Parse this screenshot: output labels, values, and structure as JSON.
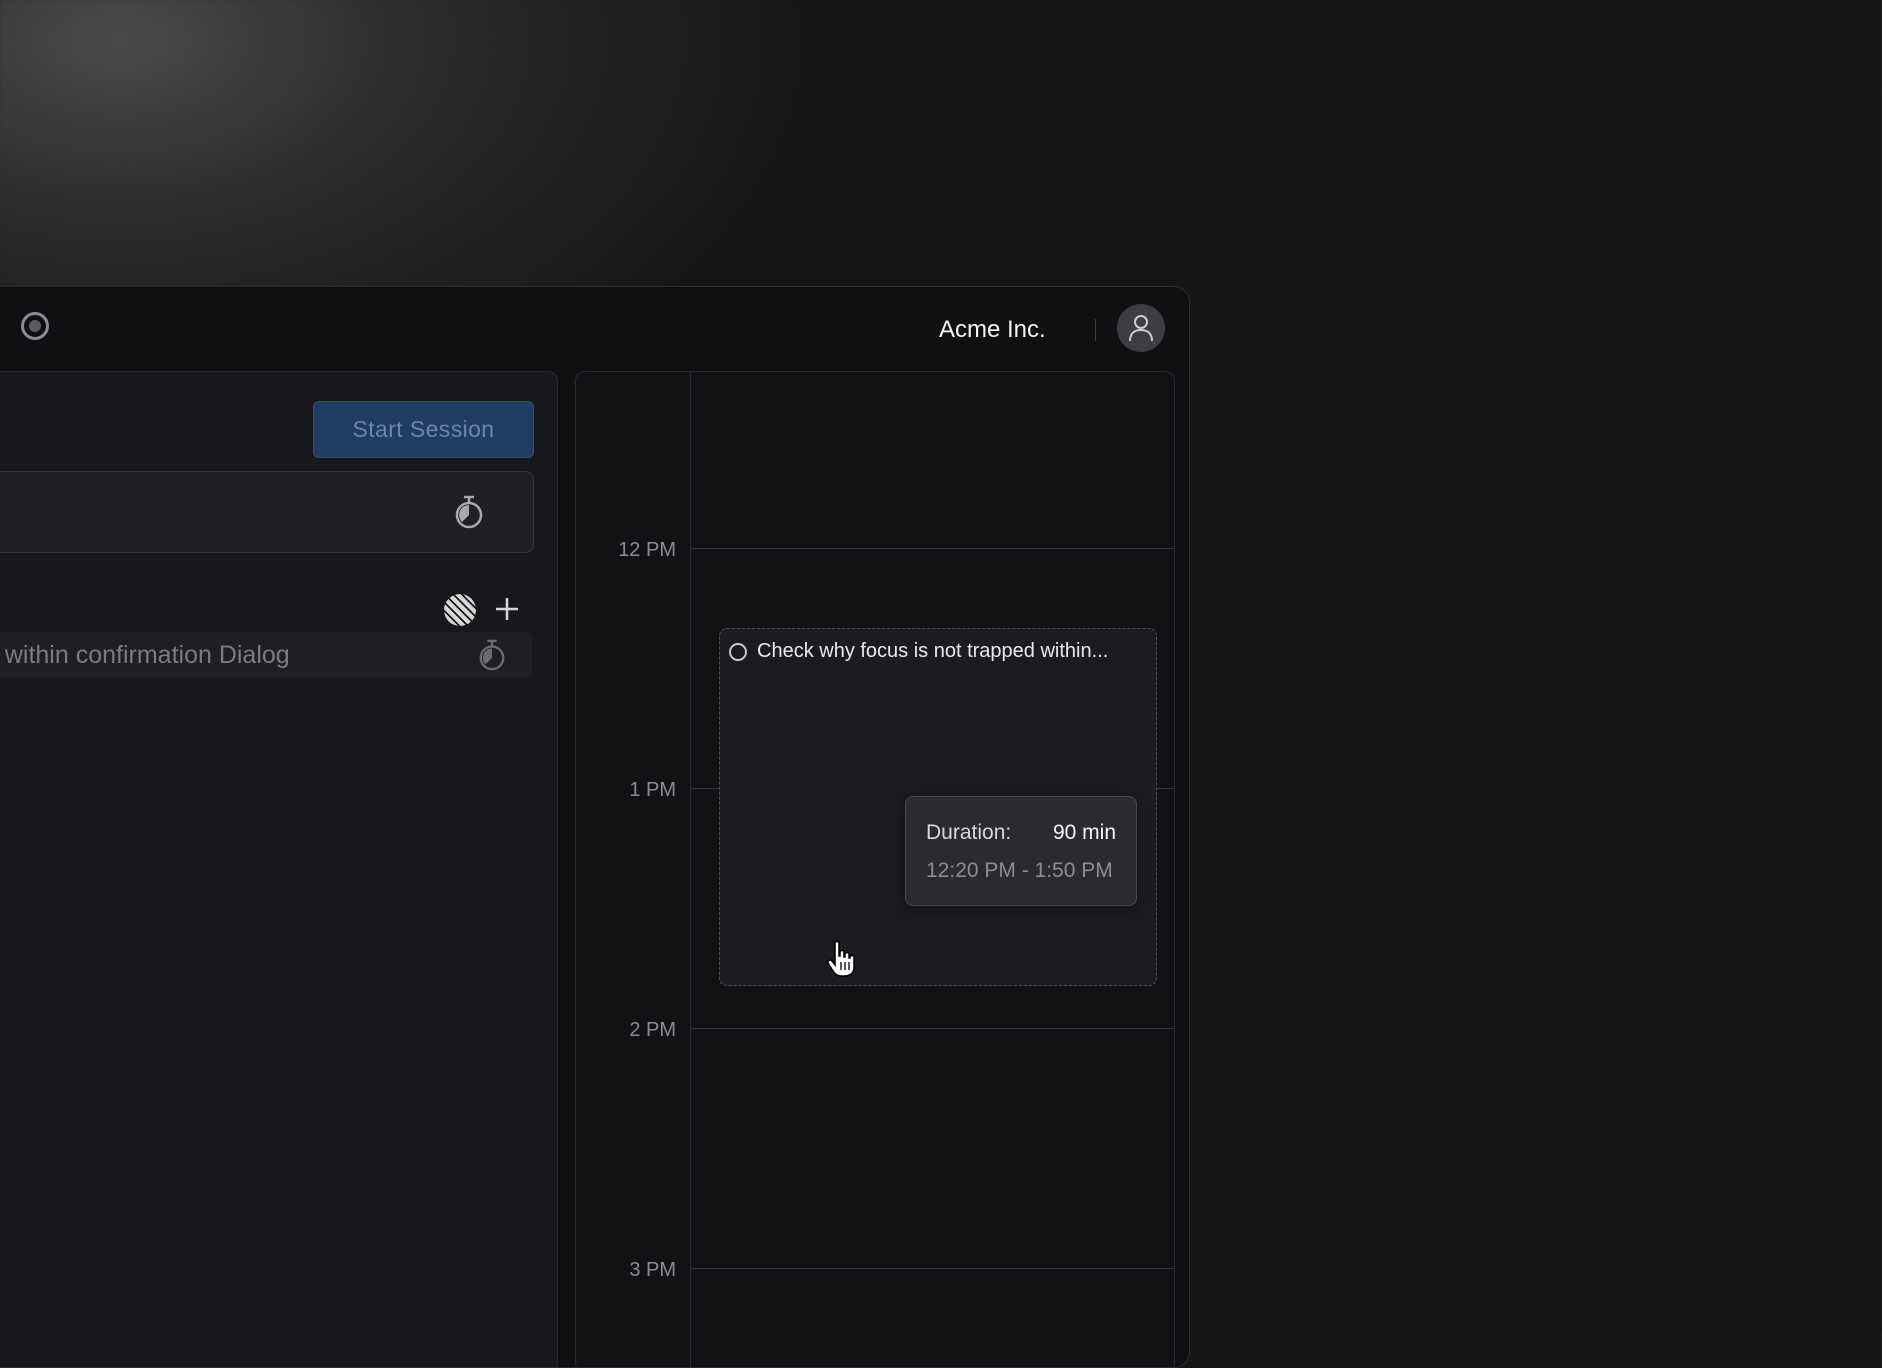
{
  "header": {
    "org_name": "Acme Inc.",
    "logo_icon": "circle-logo-icon",
    "avatar_icon": "user-icon"
  },
  "session": {
    "start_label": "Start Session"
  },
  "task_list": {
    "add_icon": "plus-icon",
    "source_icon": "linear-icon",
    "items": [
      {
        "text": "d within confirmation Dialog"
      }
    ]
  },
  "calendar": {
    "hours": [
      "12 PM",
      "1 PM",
      "2 PM",
      "3 PM"
    ],
    "event": {
      "title": "Check why focus is not trapped within..."
    },
    "tooltip": {
      "duration_label": "Duration:",
      "duration_value": "90 min",
      "time_range": "12:20 PM - 1:50 PM"
    }
  },
  "colors": {
    "accent": "#1d3d63",
    "background": "#0f1012"
  }
}
